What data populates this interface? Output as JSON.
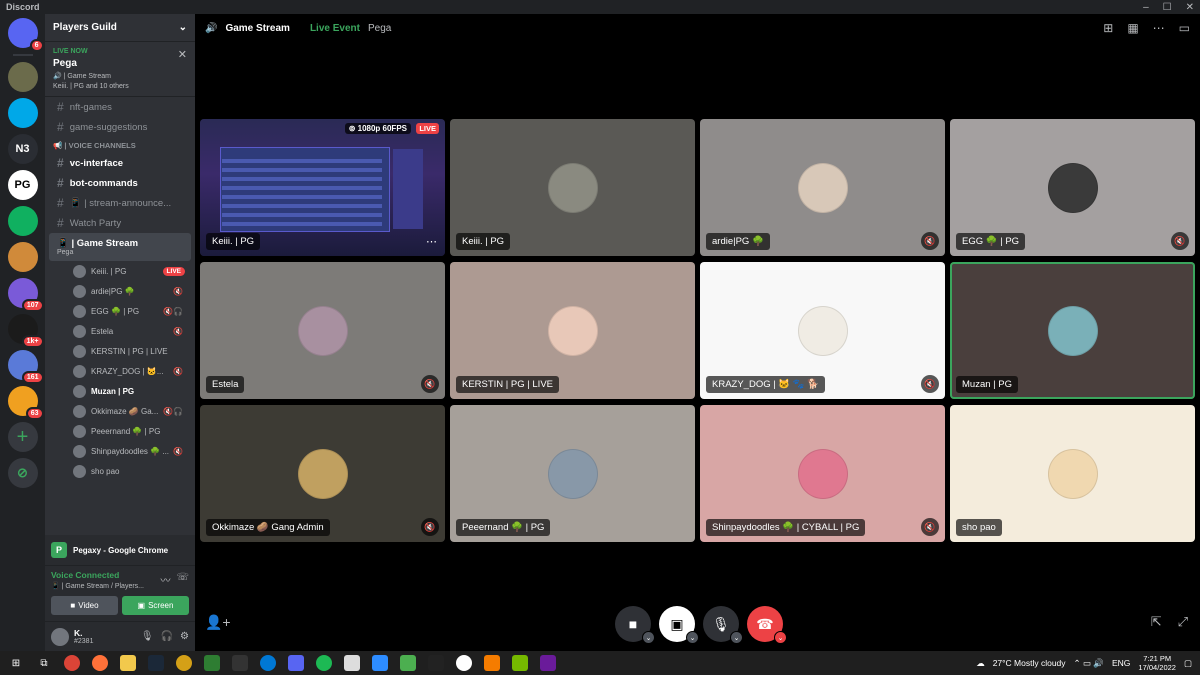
{
  "app": {
    "title": "Discord",
    "window_controls": [
      "–",
      "☐",
      "✕"
    ]
  },
  "rail": {
    "servers": [
      {
        "id": "home",
        "label": "",
        "badge": "6",
        "color": "#5865f2"
      },
      {
        "id": "srv2",
        "label": "",
        "badge": "",
        "color": "#6b6b4b"
      },
      {
        "id": "srv3",
        "label": "",
        "badge": "",
        "color": "#00a8e8"
      },
      {
        "id": "srv4",
        "label": "N3",
        "badge": "",
        "color": "#2a2d33"
      },
      {
        "id": "srv5",
        "label": "PG",
        "badge": "",
        "color": "#ffffff"
      },
      {
        "id": "srv6",
        "label": "",
        "badge": "",
        "color": "#10b060"
      },
      {
        "id": "srv7",
        "label": "",
        "badge": "",
        "color": "#d08a3a"
      },
      {
        "id": "srv8",
        "label": "",
        "badge": "107",
        "color": "#7a5ad8"
      },
      {
        "id": "srv9",
        "label": "",
        "badge": "1k+",
        "color": "#1b1b1b"
      },
      {
        "id": "srv10",
        "label": "",
        "badge": "161",
        "color": "#5a7ad8"
      },
      {
        "id": "srv11",
        "label": "",
        "badge": "63",
        "color": "#f0a020"
      }
    ]
  },
  "sidebar": {
    "guild_name": "Players Guild",
    "live": {
      "label": "LIVE NOW",
      "title": "Pega",
      "channel": "🔊 | Game Stream",
      "viewers": "Keiii. | PG and 10 others"
    },
    "channels": [
      {
        "name": "nft-games",
        "bold": false
      },
      {
        "name": "game-suggestions",
        "bold": false
      }
    ],
    "voice_category": "📢 | VOICE CHANNELS",
    "voice_channels": [
      {
        "name": "vc-interface",
        "bold": true
      },
      {
        "name": "bot-commands",
        "bold": true
      },
      {
        "name": "📱 | stream-announce...",
        "bold": false
      },
      {
        "name": "Watch Party",
        "bold": false
      }
    ],
    "active_channel": {
      "name": "📱 | Game Stream",
      "sub": "Pega"
    },
    "members": [
      {
        "name": "Keiii. | PG",
        "live": "LIVE",
        "icons": "",
        "bold": false
      },
      {
        "name": "ardie|PG 🌳",
        "live": "",
        "icons": "🔇",
        "bold": false
      },
      {
        "name": "EGG 🌳 | PG",
        "live": "",
        "icons": "🔇🎧",
        "bold": false
      },
      {
        "name": "Estela",
        "live": "",
        "icons": "🔇",
        "bold": false
      },
      {
        "name": "KERSTIN | PG | LIVE",
        "live": "",
        "icons": "",
        "bold": false
      },
      {
        "name": "KRAZY_DOG | 🐱...",
        "live": "",
        "icons": "🔇",
        "bold": false
      },
      {
        "name": "Muzan | PG",
        "live": "",
        "icons": "",
        "bold": true
      },
      {
        "name": "Okkimaze 🥔 Ga...",
        "live": "",
        "icons": "🔇🎧",
        "bold": false
      },
      {
        "name": "Peeernand 🌳 | PG",
        "live": "",
        "icons": "",
        "bold": false
      },
      {
        "name": "Shinpaydoodles 🌳 ...",
        "live": "",
        "icons": "🔇",
        "bold": false
      },
      {
        "name": "sho pao",
        "live": "",
        "icons": "",
        "bold": false
      }
    ],
    "stream_panel": {
      "app": "Pegaxy - Google Chrome"
    },
    "voice_panel": {
      "status": "Voice Connected",
      "location": "📱 | Game Stream / Players...",
      "video_label": "Video",
      "screen_label": "Screen"
    },
    "user": {
      "name": "K.",
      "tag": "#2381"
    }
  },
  "main": {
    "channel_name": "Game Stream",
    "event_label": "Live Event",
    "event_host": "Pega",
    "tiles": [
      {
        "name": "Keiii. | PG",
        "type": "stream",
        "bg": "#1a1a3a",
        "avatar": "",
        "muted": false,
        "quality": "⊚ 1080p 60FPS",
        "live": "LIVE",
        "speaking": false
      },
      {
        "name": "Keiii. | PG",
        "type": "user",
        "bg": "#5a5955",
        "avatar": "#8a8a80",
        "muted": false,
        "speaking": false
      },
      {
        "name": "ardie|PG 🌳",
        "type": "user",
        "bg": "#8f8c8b",
        "avatar": "#d8c8b8",
        "muted": true,
        "speaking": false
      },
      {
        "name": "EGG 🌳 | PG",
        "type": "user",
        "bg": "#a4a0a0",
        "avatar": "#3a3a3a",
        "muted": true,
        "speaking": false
      },
      {
        "name": "Estela",
        "type": "user",
        "bg": "#7d7b78",
        "avatar": "#a890a0",
        "muted": true,
        "speaking": false
      },
      {
        "name": "KERSTIN | PG | LIVE",
        "type": "user",
        "bg": "#ad9a92",
        "avatar": "#e8c8b8",
        "muted": false,
        "speaking": false
      },
      {
        "name": "KRAZY_DOG | 🐱 🐾 🐕",
        "type": "user",
        "bg": "#f8f8f8",
        "avatar": "#f0ece4",
        "muted": true,
        "speaking": false
      },
      {
        "name": "Muzan | PG",
        "type": "user",
        "bg": "#4a3f3d",
        "avatar": "#7ab0b8",
        "muted": false,
        "speaking": true
      },
      {
        "name": "Okkimaze 🥔 Gang Admin",
        "type": "user",
        "bg": "#3d3b34",
        "avatar": "#c0a060",
        "muted": true,
        "speaking": false
      },
      {
        "name": "Peeernand 🌳 | PG",
        "type": "user",
        "bg": "#a6a09a",
        "avatar": "#8898a8",
        "muted": false,
        "speaking": false
      },
      {
        "name": "Shinpaydoodles 🌳 | CYBALL | PG",
        "type": "user",
        "bg": "#d8a6a5",
        "avatar": "#e07890",
        "muted": true,
        "speaking": false
      },
      {
        "name": "sho pao",
        "type": "user",
        "bg": "#f4ecdc",
        "avatar": "#f0d8b0",
        "muted": false,
        "speaking": false
      }
    ]
  },
  "taskbar": {
    "weather": "27°C  Mostly cloudy",
    "lang": "ENG",
    "time": "7:21 PM",
    "date": "17/04/2022"
  }
}
